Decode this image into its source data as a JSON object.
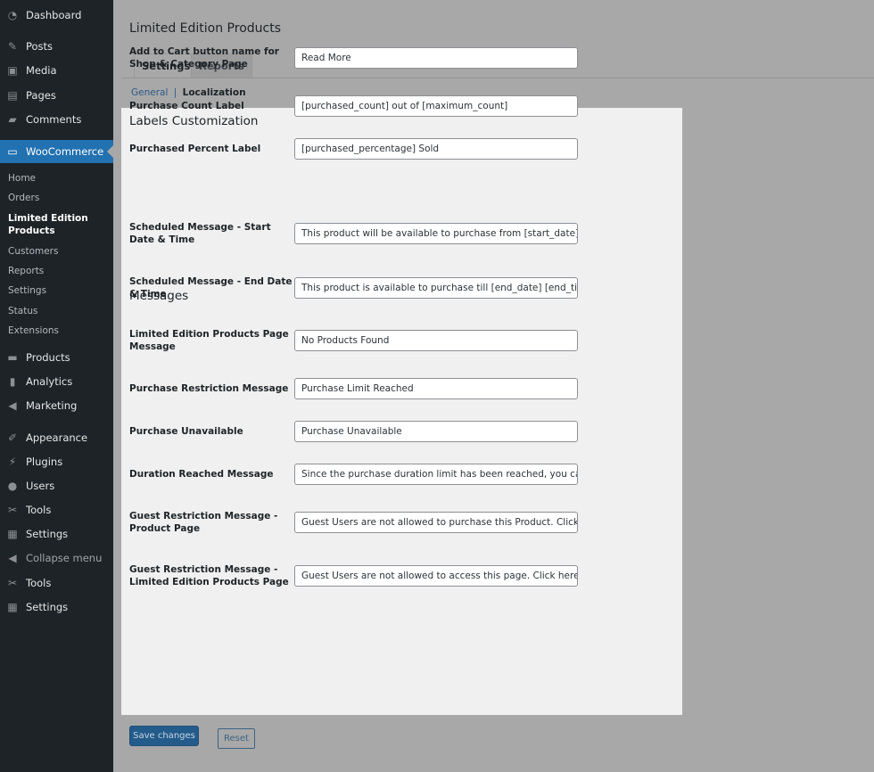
{
  "sidebar": {
    "items": [
      {
        "label": "Dashboard",
        "icon": "dashboard-icon",
        "glyph": "◔"
      },
      {
        "label": "Posts",
        "icon": "pin-icon",
        "glyph": "✎"
      },
      {
        "label": "Media",
        "icon": "media-icon",
        "glyph": "▣"
      },
      {
        "label": "Pages",
        "icon": "pages-icon",
        "glyph": "▤"
      },
      {
        "label": "Comments",
        "icon": "comment-icon",
        "glyph": "▰"
      },
      {
        "label": "WooCommerce",
        "icon": "woo-icon",
        "glyph": "▭"
      },
      {
        "label": "Products",
        "icon": "archive-icon",
        "glyph": "▬"
      },
      {
        "label": "Analytics",
        "icon": "chart-bar-icon",
        "glyph": "▮"
      },
      {
        "label": "Marketing",
        "icon": "megaphone-icon",
        "glyph": "◀"
      },
      {
        "label": "Appearance",
        "icon": "brush-icon",
        "glyph": "✐"
      },
      {
        "label": "Plugins",
        "icon": "plug-icon",
        "glyph": "⚡"
      },
      {
        "label": "Users",
        "icon": "user-icon",
        "glyph": "●"
      },
      {
        "label": "Tools",
        "icon": "wrench-icon",
        "glyph": "✂"
      },
      {
        "label": "Settings",
        "icon": "sliders-icon",
        "glyph": "▦"
      },
      {
        "label": "Collapse menu",
        "icon": "collapse-icon",
        "glyph": "◀"
      },
      {
        "label": "Tools",
        "icon": "wrench-icon",
        "glyph": "✂"
      },
      {
        "label": "Settings",
        "icon": "sliders-icon",
        "glyph": "▦"
      }
    ],
    "submenu": [
      "Home",
      "Orders",
      "Limited Edition Products",
      "Customers",
      "Reports",
      "Settings",
      "Status",
      "Extensions"
    ]
  },
  "header": {
    "title": "Limited Edition Products",
    "tabs": [
      "Settings",
      "Reports"
    ],
    "subnav": {
      "general": "General",
      "sep": "|",
      "current": "Localization"
    }
  },
  "sections": {
    "labels": "Labels Customization",
    "messages": "Messages"
  },
  "fields": [
    {
      "label": "Add to Cart button name for Shop & Category Page",
      "value": "Read More"
    },
    {
      "label": "Purchase Count Label",
      "value": "[purchased_count] out of [maximum_count]"
    },
    {
      "label": "Purchased Percent Label",
      "value": "[purchased_percentage] Sold"
    },
    {
      "label": "Scheduled Message - Start Date & Time",
      "value": "This product will be available to purchase from [start_date] [start_time]"
    },
    {
      "label": "Scheduled Message - End Date & Time",
      "value": "This product is available to purchase till [end_date] [end_time]"
    },
    {
      "label": "Limited Edition Products Page Message",
      "value": "No Products Found"
    },
    {
      "label": "Purchase Restriction Message",
      "value": "Purchase Limit Reached"
    },
    {
      "label": "Purchase Unavailable",
      "value": "Purchase Unavailable"
    },
    {
      "label": "Duration Reached Message",
      "value": "Since the purchase duration limit has been reached, you cannot"
    },
    {
      "label": "Guest Restriction Message - Product Page",
      "value": "Guest Users are not allowed to purchase this Product. Click here"
    },
    {
      "label": "Guest Restriction Message - Limited Edition Products Page",
      "value": "Guest Users are not allowed to access this page. Click here to"
    }
  ],
  "actions": {
    "save": "Save changes",
    "reset": "Reset"
  }
}
